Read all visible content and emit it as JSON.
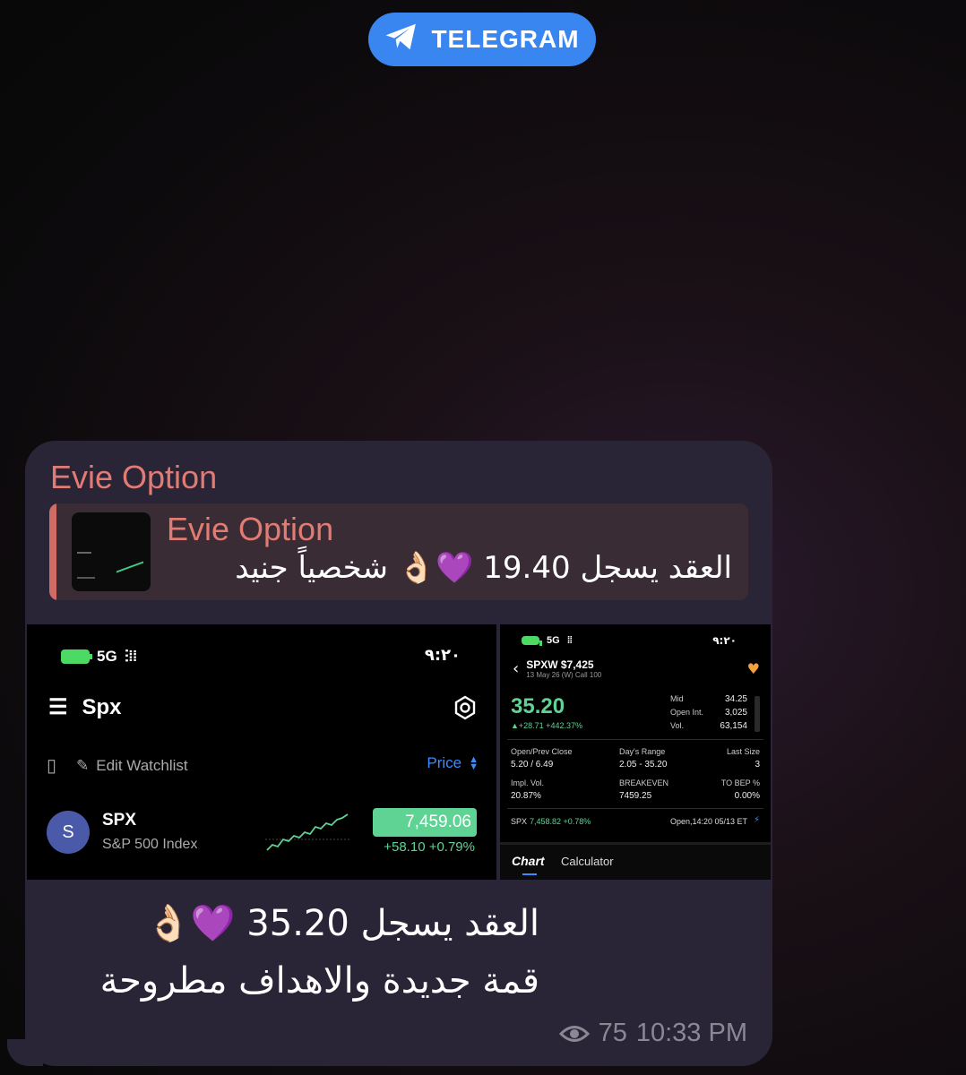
{
  "badge": {
    "label": "TELEGRAM",
    "color": "#3a86f0",
    "icon": "telegram-paper-plane-icon"
  },
  "message": {
    "sender": "Evie Option",
    "reply": {
      "name": "Evie Option",
      "text": "العقد يسجل 19.40 💜👌🏻 شخصياً جنيد"
    },
    "line1": "العقد يسجل 35.20 💜👌🏻",
    "line2": "قمة جديدة والاهداف مطروحة",
    "views": "75",
    "time": "10:33 PM"
  },
  "photo_left": {
    "network": "5G",
    "time": "٩:٢٠",
    "title": "Spx",
    "edit_watchlist": "Edit Watchlist",
    "sort_label": "Price",
    "row": {
      "avatar": "S",
      "symbol": "SPX",
      "name": "S&P 500 Index",
      "price": "7,459.06",
      "change": "+58.10 +0.79%"
    }
  },
  "photo_right": {
    "network": "5G",
    "time": "٩:٢٠",
    "contract": "SPXW $7,425",
    "subtitle": "13 May 26 (W) Call 100",
    "price": "35.20",
    "change": "▲+28.71 +442.37%",
    "stats": [
      {
        "label": "Mid",
        "value": "34.25"
      },
      {
        "label": "Open Int.",
        "value": "3,025"
      },
      {
        "label": "Vol.",
        "value": "63,154"
      }
    ],
    "grid": [
      {
        "label": "Open/Prev Close",
        "value": "5.20 / 6.49"
      },
      {
        "label": "Day's Range",
        "value": "2.05 - 35.20"
      },
      {
        "label": "Last Size",
        "value": "3"
      },
      {
        "label": "Impl. Vol.",
        "value": "20.87%"
      },
      {
        "label": "BREAKEVEN",
        "value": "7459.25"
      },
      {
        "label": "TO BEP %",
        "value": "0.00%"
      }
    ],
    "underlying_sym": "SPX",
    "underlying_quote": "7,458.82 +0.78%",
    "open_status": "Open,14:20 05/13 ET",
    "tab_chart": "Chart",
    "tab_calculator": "Calculator"
  }
}
